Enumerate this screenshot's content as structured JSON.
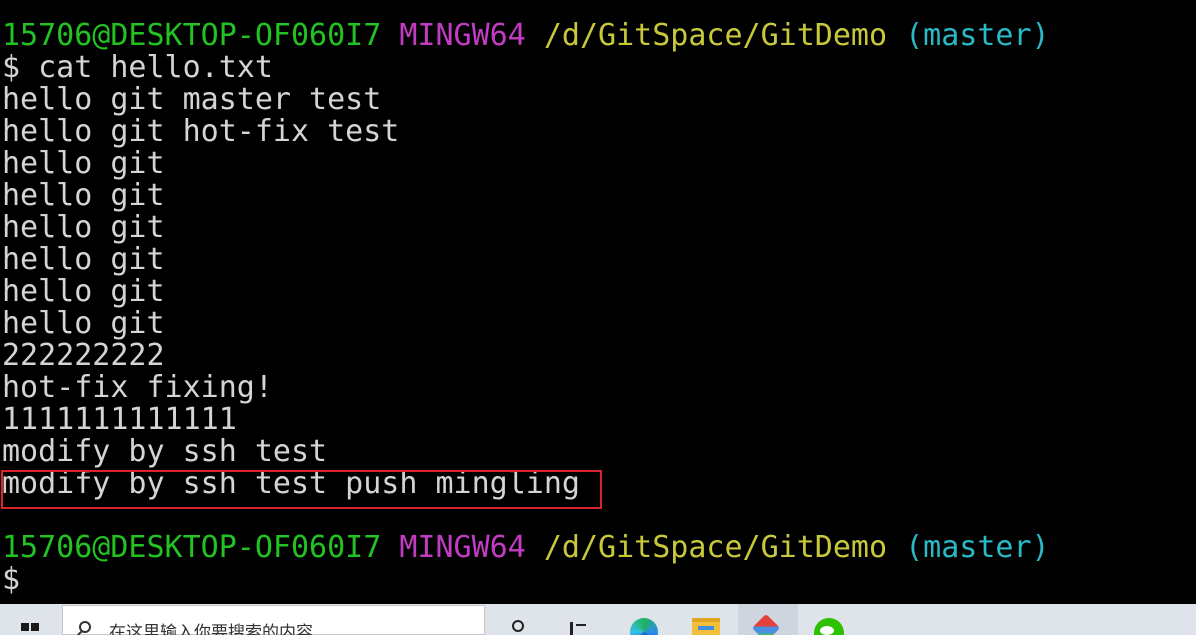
{
  "terminal": {
    "prompt": {
      "user_host": "15706@DESKTOP-OF060I7",
      "system": "MINGW64",
      "path": "/d/GitSpace/GitDemo",
      "branch": "(master)"
    },
    "command_line": "$ cat hello.txt",
    "output": [
      "hello git master test",
      "hello git hot-fix test",
      "hello git",
      "hello git",
      "hello git",
      "hello git",
      "hello git",
      "hello git",
      "222222222",
      "hot-fix fixing!",
      "1111111111111",
      "modify by ssh test",
      "modify by ssh test push mingling"
    ],
    "cursor_prompt": "$",
    "colors": {
      "background": "#000000",
      "text": "#d4d4d4",
      "user_host": "#23c223",
      "system": "#c13cc1",
      "path": "#c8c83a",
      "branch": "#2ab9c7",
      "highlight_box": "#d9232d"
    }
  },
  "taskbar": {
    "start_icon": "windows-logo-icon",
    "search": {
      "icon": "search-icon",
      "placeholder": "在这里输入你要搜索的内容"
    },
    "icons": [
      "task-view-icon",
      "widgets-icon",
      "edge-browser-icon",
      "file-explorer-icon",
      "git-app-icon",
      "wechat-icon"
    ],
    "background": "#dfe3ea"
  }
}
